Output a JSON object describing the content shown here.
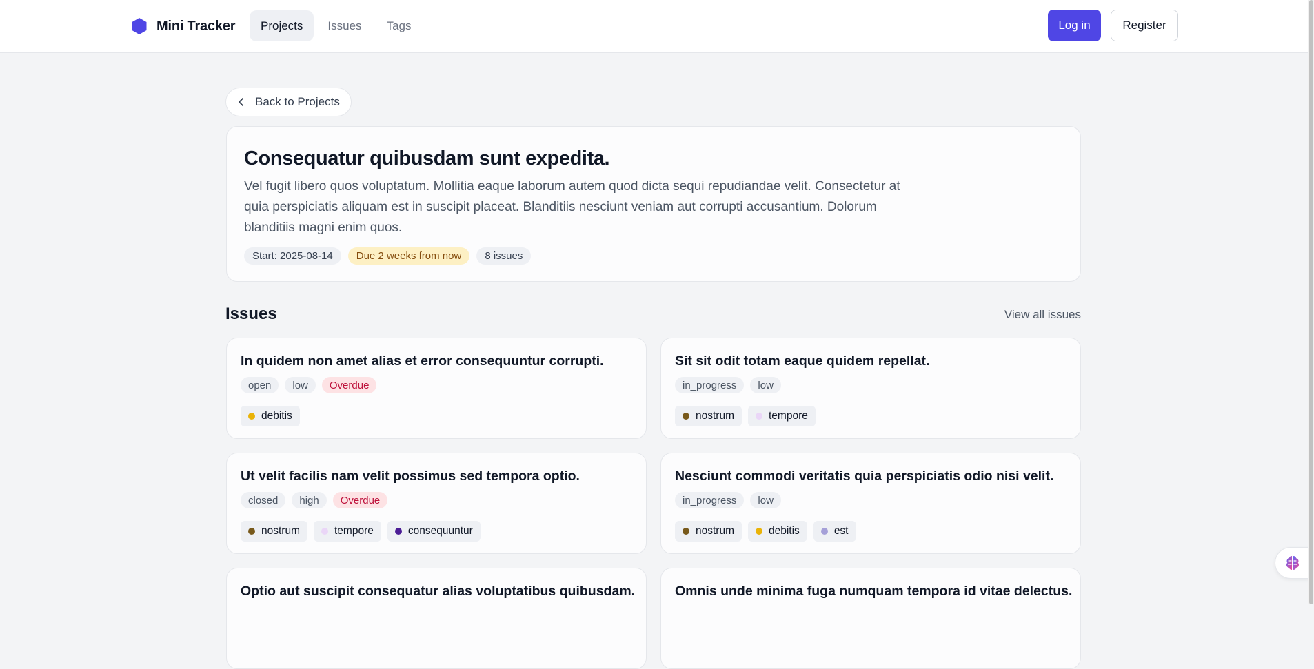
{
  "nav": {
    "brand": "Mini Tracker",
    "brand_icon": "hexagon-logo-icon",
    "links": [
      {
        "label": "Projects",
        "active": true
      },
      {
        "label": "Issues",
        "active": false
      },
      {
        "label": "Tags",
        "active": false
      }
    ],
    "login": "Log in",
    "register": "Register"
  },
  "back": {
    "label": "Back to Projects",
    "icon": "chevron-left-icon"
  },
  "project": {
    "title": "Consequatur quibusdam sunt expedita.",
    "description": "Vel fugit libero quos voluptatum. Mollitia eaque laborum autem quod dicta sequi repudiandae velit. Consectetur at quia perspiciatis aliquam est in suscipit placeat. Blanditiis nesciunt veniam aut corrupti accusantium. Dolorum blanditiis magni enim quos.",
    "start": "Start: 2025-08-14",
    "due": "Due 2 weeks from now",
    "issue_count": "8 issues"
  },
  "issues_section": {
    "heading": "Issues",
    "view_all": "View all issues"
  },
  "issues": [
    {
      "title": "In quidem non amet alias et error consequuntur corrupti.",
      "status": "open",
      "priority": "low",
      "overdue": "Overdue",
      "tags": [
        {
          "name": "debitis",
          "color": "#eab308"
        }
      ]
    },
    {
      "title": "Sit sit odit totam eaque quidem repellat.",
      "status": "in_progress",
      "priority": "low",
      "overdue": "",
      "tags": [
        {
          "name": "nostrum",
          "color": "#78591b"
        },
        {
          "name": "tempore",
          "color": "#ead6f7"
        }
      ]
    },
    {
      "title": "Ut velit facilis nam velit possimus sed tempora optio.",
      "status": "closed",
      "priority": "high",
      "overdue": "Overdue",
      "tags": [
        {
          "name": "nostrum",
          "color": "#78591b"
        },
        {
          "name": "tempore",
          "color": "#ead6f7"
        },
        {
          "name": "consequuntur",
          "color": "#4c1d95"
        }
      ]
    },
    {
      "title": "Nesciunt commodi veritatis quia perspiciatis odio nisi velit.",
      "status": "in_progress",
      "priority": "low",
      "overdue": "",
      "tags": [
        {
          "name": "nostrum",
          "color": "#78591b"
        },
        {
          "name": "debitis",
          "color": "#eab308"
        },
        {
          "name": "est",
          "color": "#a5a0d8"
        }
      ]
    },
    {
      "title": "Optio aut suscipit consequatur alias voluptatibus quibusdam.",
      "status": "",
      "priority": "",
      "overdue": "",
      "tags": []
    },
    {
      "title": "Omnis unde minima fuga numquam tempora id vitae delectus.",
      "status": "",
      "priority": "",
      "overdue": "",
      "tags": []
    }
  ],
  "colors": {
    "accent": "#4f46e5",
    "overdue_bg": "#fde2e4",
    "overdue_text": "#be123c",
    "due_bg": "#fdf0c4"
  },
  "floating_button_icon": "brain-icon"
}
